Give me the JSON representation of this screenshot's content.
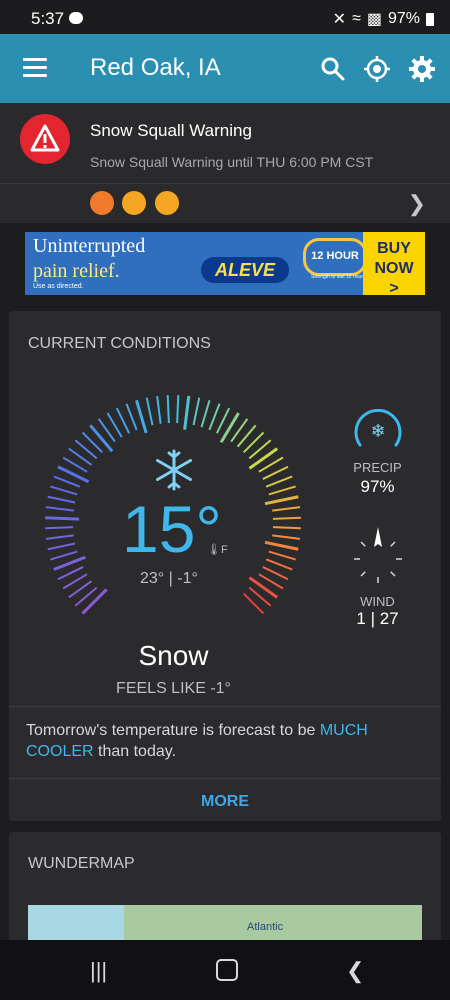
{
  "status_bar": {
    "time": "5:37",
    "battery": "97%"
  },
  "app_bar": {
    "title": "Red Oak, IA",
    "icons": [
      "menu-icon",
      "search-icon",
      "locate-icon",
      "settings-icon"
    ]
  },
  "alert": {
    "title": "Snow Squall Warning",
    "detail": "Snow Squall Warning until THU 6:00 PM CST",
    "badges": [
      "warning-icon",
      "thermometer-icon",
      "thermometer-icon"
    ]
  },
  "ad": {
    "line1": "Uninterrupted",
    "line2": "pain relief.",
    "line3": "Use as directed.",
    "brand": "ALEVE",
    "badge": "12 HOUR",
    "small": "Strength to last 12 hours.",
    "cta_1": "BUY",
    "cta_2": "NOW",
    "cta_3": ">"
  },
  "current": {
    "heading": "CURRENT CONDITIONS",
    "temperature": "15°",
    "unit": "F",
    "hilo": "23° | -1°",
    "condition": "Snow",
    "feels_like": "FEELS LIKE -1°",
    "precip_label": "PRECIP",
    "precip_value": "97%",
    "wind_label": "WIND",
    "wind_speed": "1",
    "wind_gust": "27",
    "forecast_pre": "Tomorrow's temperature is forecast to be ",
    "forecast_em": "MUCH COOLER",
    "forecast_post": " than today.",
    "more": "MORE"
  },
  "wundermap": {
    "heading": "WUNDERMAP",
    "map_label": "Atlantic"
  },
  "colors": {
    "accent": "#2a8fb1",
    "temp": "#3fb7ea",
    "alert": "#e2252f"
  }
}
